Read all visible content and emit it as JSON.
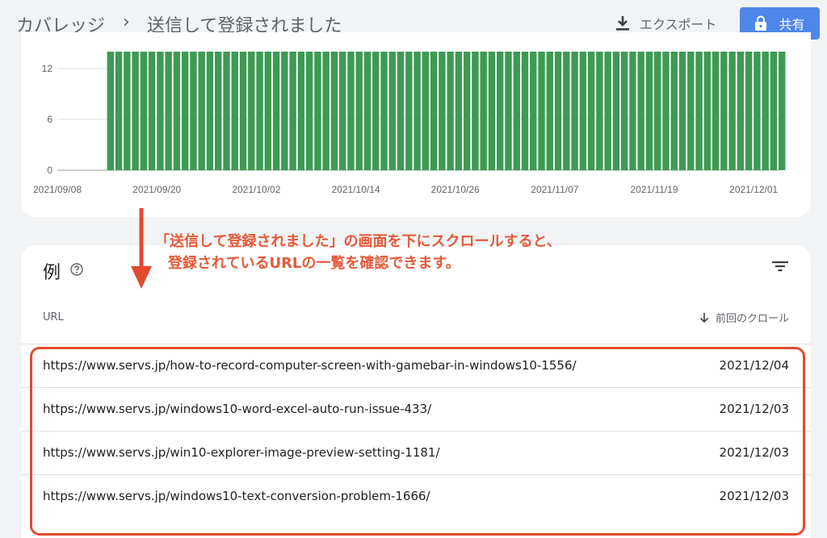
{
  "header": {
    "breadcrumb_root": "カバレッジ",
    "breadcrumb_sep": "›",
    "title": "送信して登録されました",
    "export_label": "エクスポート",
    "share_label": "共有"
  },
  "chart_data": {
    "type": "bar",
    "ylim": [
      0,
      14
    ],
    "y_ticks": [
      "0",
      "6",
      "12"
    ],
    "x_tick_labels": [
      "2021/09/08",
      "2021/09/20",
      "2021/10/02",
      "2021/10/14",
      "2021/10/26",
      "2021/11/07",
      "2021/11/19",
      "2021/12/01"
    ],
    "bar_color": "#3d9a53",
    "x_range": [
      "2021/09/08",
      "2021/12/04"
    ],
    "first_bar_date": "2021/09/14",
    "bar_count": 82,
    "bar_value": 14
  },
  "examples": {
    "title": "例",
    "col_url": "URL",
    "col_crawl": "前回のクロール",
    "rows": [
      {
        "url": "https://www.servs.jp/how-to-record-computer-screen-with-gamebar-in-windows10-1556/",
        "date": "2021/12/04"
      },
      {
        "url": "https://www.servs.jp/windows10-word-excel-auto-run-issue-433/",
        "date": "2021/12/03"
      },
      {
        "url": "https://www.servs.jp/win10-explorer-image-preview-setting-1181/",
        "date": "2021/12/03"
      },
      {
        "url": "https://www.servs.jp/windows10-text-conversion-problem-1666/",
        "date": "2021/12/03"
      }
    ]
  },
  "annotation": {
    "line1": "「送信して登録されました」の画面を下にスクロールすると、",
    "line2": "登録されているURLの一覧を確認できます。",
    "color": "#e34a2f"
  }
}
